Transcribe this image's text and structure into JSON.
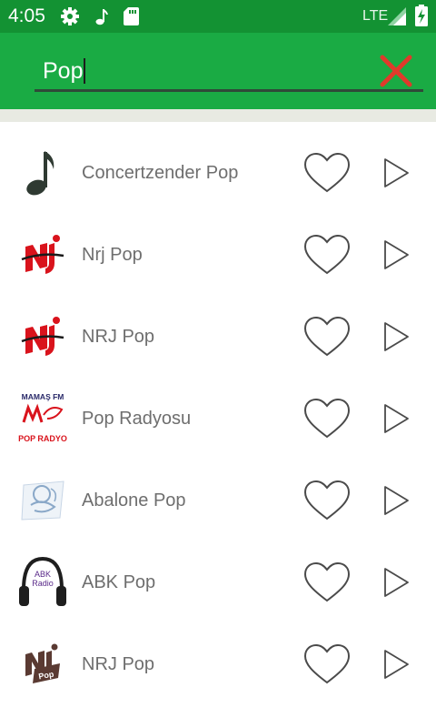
{
  "status_bar": {
    "time": "4:05",
    "network": "LTE",
    "icons": [
      "settings-icon",
      "music-note-icon",
      "sd-card-icon",
      "signal-icon",
      "battery-icon"
    ]
  },
  "search": {
    "value": "Pop",
    "clear_icon": "close-icon"
  },
  "colors": {
    "status_bar": "#139233",
    "toolbar": "#1aab44",
    "clear_icon": "#e03a2b",
    "list_text": "#6e6e6e",
    "icon_stroke": "#4a4a4a"
  },
  "stations": [
    {
      "name": "Concertzender Pop",
      "logo": "music-note-logo"
    },
    {
      "name": "Nrj Pop",
      "logo": "nrj-logo"
    },
    {
      "name": "NRJ Pop",
      "logo": "nrj-logo"
    },
    {
      "name": "Pop Radyosu",
      "logo": "mamas-fm-logo",
      "logo_text": [
        "MAMAŞ FM",
        "POP RADYO"
      ]
    },
    {
      "name": "Abalone Pop",
      "logo": "abalone-logo"
    },
    {
      "name": "ABK Pop",
      "logo": "headphones-logo",
      "logo_text": [
        "ABK",
        "Radio"
      ]
    },
    {
      "name": "NRJ Pop",
      "logo": "nrj-pop-logo"
    }
  ],
  "row_actions": {
    "favorite_icon": "heart-outline-icon",
    "play_icon": "play-icon"
  }
}
